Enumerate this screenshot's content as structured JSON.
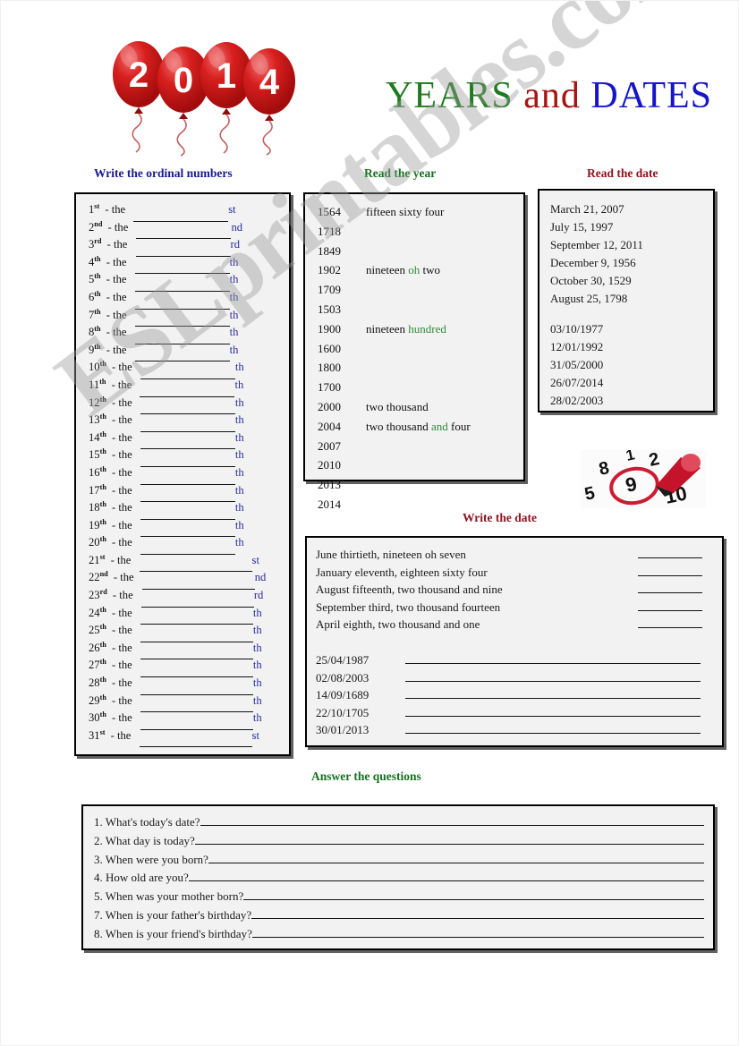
{
  "watermark": {
    "text": "ESLprintables.com"
  },
  "header": {
    "title_years": "YEARS",
    "title_and": "and",
    "title_dates": "DATES",
    "balloon_digits": [
      "2",
      "0",
      "1",
      "4"
    ],
    "balloon_color": "#cc1111",
    "colors": {
      "years": "#1d7a1d",
      "and": "#a71414",
      "dates": "#1414c8"
    }
  },
  "sections": {
    "ordinal_heading": "Write the ordinal numbers",
    "year_heading": "Read the year",
    "read_date_heading": "Read the date",
    "write_date_heading": "Write the date",
    "answer_heading": "Answer the questions",
    "heading_colors": {
      "blue": "#1b1b8f",
      "green": "#14711e",
      "red": "#8e1420"
    }
  },
  "ordinals": {
    "connector": "- the",
    "items": [
      {
        "num": "1",
        "sup": "st",
        "suffix": "st",
        "blank": 106
      },
      {
        "num": "2",
        "sup": "nd",
        "suffix": "nd",
        "blank": 106
      },
      {
        "num": "3",
        "sup": "rd",
        "suffix": "rd",
        "blank": 106
      },
      {
        "num": "4",
        "sup": "th",
        "suffix": "th",
        "blank": 106
      },
      {
        "num": "5",
        "sup": "th",
        "suffix": "th",
        "blank": 106
      },
      {
        "num": "6",
        "sup": "th",
        "suffix": "th",
        "blank": 106
      },
      {
        "num": "7",
        "sup": "th",
        "suffix": "th",
        "blank": 106
      },
      {
        "num": "8",
        "sup": "th",
        "suffix": "th",
        "blank": 106
      },
      {
        "num": "9",
        "sup": "th",
        "suffix": "th",
        "blank": 106
      },
      {
        "num": "10",
        "sup": "th",
        "suffix": "th",
        "blank": 106
      },
      {
        "num": "11",
        "sup": "th",
        "suffix": "th",
        "blank": 106
      },
      {
        "num": "12",
        "sup": "th",
        "suffix": "th",
        "blank": 106
      },
      {
        "num": "13",
        "sup": "th",
        "suffix": "th",
        "blank": 106
      },
      {
        "num": "14",
        "sup": "th",
        "suffix": "th",
        "blank": 106
      },
      {
        "num": "15",
        "sup": "th",
        "suffix": "th",
        "blank": 106
      },
      {
        "num": "16",
        "sup": "th",
        "suffix": "th",
        "blank": 106
      },
      {
        "num": "17",
        "sup": "th",
        "suffix": "th",
        "blank": 106
      },
      {
        "num": "18",
        "sup": "th",
        "suffix": "th",
        "blank": 106
      },
      {
        "num": "19",
        "sup": "th",
        "suffix": "th",
        "blank": 106
      },
      {
        "num": "20",
        "sup": "th",
        "suffix": "th",
        "blank": 106
      },
      {
        "num": "21",
        "sup": "st",
        "suffix": "st",
        "blank": 126
      },
      {
        "num": "22",
        "sup": "nd",
        "suffix": "nd",
        "blank": 126
      },
      {
        "num": "23",
        "sup": "rd",
        "suffix": "rd",
        "blank": 126
      },
      {
        "num": "24",
        "sup": "th",
        "suffix": "th",
        "blank": 126
      },
      {
        "num": "25",
        "sup": "th",
        "suffix": "th",
        "blank": 126
      },
      {
        "num": "26",
        "sup": "th",
        "suffix": "th",
        "blank": 126
      },
      {
        "num": "27",
        "sup": "th",
        "suffix": "th",
        "blank": 126
      },
      {
        "num": "28",
        "sup": "th",
        "suffix": "th",
        "blank": 126
      },
      {
        "num": "29",
        "sup": "th",
        "suffix": "th",
        "blank": 126
      },
      {
        "num": "30",
        "sup": "th",
        "suffix": "th",
        "blank": 126
      },
      {
        "num": "31",
        "sup": "st",
        "suffix": "st",
        "blank": 126
      }
    ]
  },
  "years": [
    {
      "year": "1564",
      "words": [
        {
          "t": "fifteen sixty four",
          "c": "black"
        }
      ]
    },
    {
      "year": "1718",
      "words": []
    },
    {
      "year": "1849",
      "words": []
    },
    {
      "year": "1902",
      "words": [
        {
          "t": "nineteen ",
          "c": "black"
        },
        {
          "t": "oh",
          "c": "green"
        },
        {
          "t": " two",
          "c": "black"
        }
      ]
    },
    {
      "year": "1709",
      "words": []
    },
    {
      "year": "1503",
      "words": []
    },
    {
      "year": "1900",
      "words": [
        {
          "t": "nineteen ",
          "c": "black"
        },
        {
          "t": "hundred",
          "c": "green"
        }
      ]
    },
    {
      "year": "1600",
      "words": []
    },
    {
      "year": "1800",
      "words": []
    },
    {
      "year": "1700",
      "words": []
    },
    {
      "year": "2000",
      "words": [
        {
          "t": "two thousand",
          "c": "black"
        }
      ]
    },
    {
      "year": "2004",
      "words": [
        {
          "t": "two thousand ",
          "c": "black"
        },
        {
          "t": "and",
          "c": "green"
        },
        {
          "t": " four",
          "c": "black"
        }
      ]
    },
    {
      "year": "2007",
      "words": []
    },
    {
      "year": "2010",
      "words": []
    },
    {
      "year": "2013",
      "words": []
    },
    {
      "year": "2014",
      "words": []
    }
  ],
  "read_dates": {
    "long_form": [
      "March 21, 2007",
      "July 15, 1997",
      "September 12, 2011",
      "December 9, 1956",
      "October 30, 1529",
      "August 25, 1798"
    ],
    "numeric_form": [
      "03/10/1977",
      "12/01/1992",
      "31/05/2000",
      "26/07/2014",
      "28/02/2003"
    ]
  },
  "calendar_image": {
    "numbers": [
      "8",
      "1",
      "2",
      "9",
      "5",
      "10"
    ],
    "circled_number": "9",
    "marker_color": "#cc1c33"
  },
  "write_dates": {
    "spelled": [
      "June thirtieth, nineteen oh seven",
      "January eleventh, eighteen sixty four",
      "August fifteenth, two thousand and nine",
      "September third, two thousand fourteen",
      "April eighth, two thousand and one"
    ],
    "numeric": [
      "25/04/1987",
      "02/08/2003",
      "14/09/1689",
      "22/10/1705",
      "30/01/2013"
    ]
  },
  "questions": [
    {
      "text": "1. What's today's date?",
      "line": 330
    },
    {
      "text": "2. What day is today?",
      "line": 330
    },
    {
      "text": "3. When were you born?",
      "line": 330
    },
    {
      "text": "4. How old are you?",
      "line": 330
    },
    {
      "text": "5. When was your mother born?",
      "line": 330
    },
    {
      "text": "7. When is your father's birthday?",
      "line": 330
    },
    {
      "text": "8. When is your friend's birthday?",
      "line": 330
    }
  ]
}
